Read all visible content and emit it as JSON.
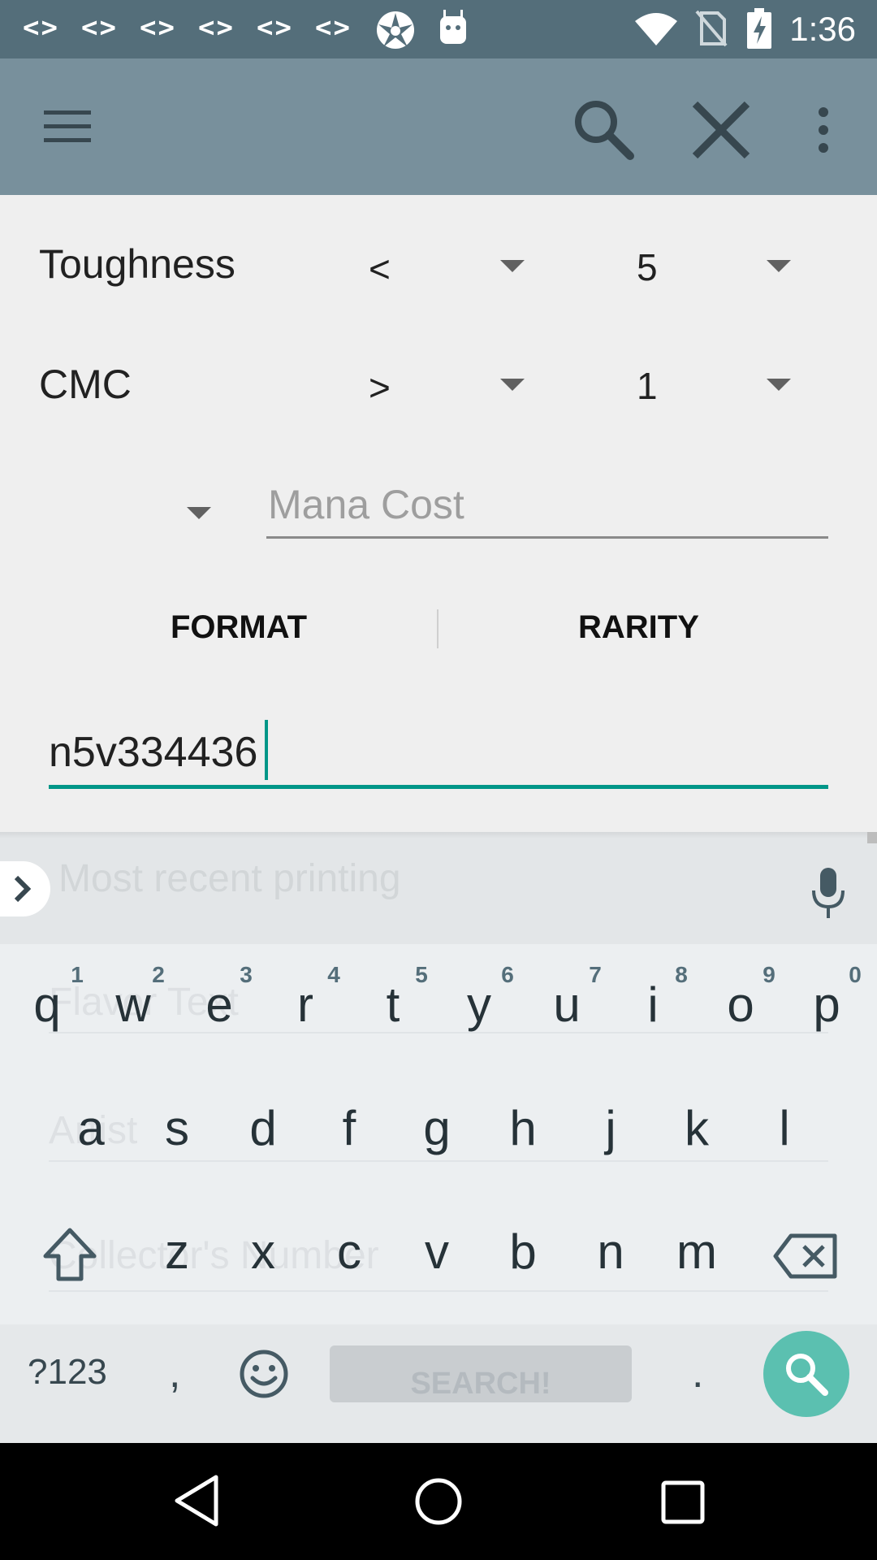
{
  "status_bar": {
    "notification_icons": [
      "code-icon",
      "code-icon",
      "code-icon",
      "code-icon",
      "code-icon",
      "code-icon",
      "aperture-icon",
      "android-icon"
    ],
    "code_glyph": "<>",
    "time": "1:36"
  },
  "toolbar": {
    "menu_icon": "menu-icon",
    "search_icon": "search-icon",
    "close_icon": "close-icon",
    "overflow_icon": "more-vert-icon"
  },
  "form": {
    "toughness": {
      "label": "Toughness",
      "operator": "<",
      "value": "5"
    },
    "cmc": {
      "label": "CMC",
      "operator": ">",
      "value": "1"
    },
    "mana_cost": {
      "placeholder": "Mana Cost"
    },
    "tabs": [
      "FORMAT",
      "RARITY"
    ],
    "name_input": {
      "value": "n5v334436"
    },
    "hidden_behind_keyboard": {
      "printing_select": "Most recent printing",
      "flavor_text": "Flavor Text",
      "artist": "Artist",
      "collectors_number": "Collector's Number",
      "search_button": "SEARCH!"
    }
  },
  "keyboard": {
    "row1": [
      "q",
      "w",
      "e",
      "r",
      "t",
      "y",
      "u",
      "i",
      "o",
      "p"
    ],
    "row1_hints": [
      "1",
      "2",
      "3",
      "4",
      "5",
      "6",
      "7",
      "8",
      "9",
      "0"
    ],
    "row2": [
      "a",
      "s",
      "d",
      "f",
      "g",
      "h",
      "j",
      "k",
      "l"
    ],
    "row3": [
      "z",
      "x",
      "c",
      "v",
      "b",
      "n",
      "m"
    ],
    "symbols_label": "?123",
    "comma": ",",
    "period": ".",
    "action_color": "#5BC0B0"
  },
  "colors": {
    "status_bar": "#546E7A",
    "app_bar": "#78909C",
    "accent": "#009688"
  }
}
